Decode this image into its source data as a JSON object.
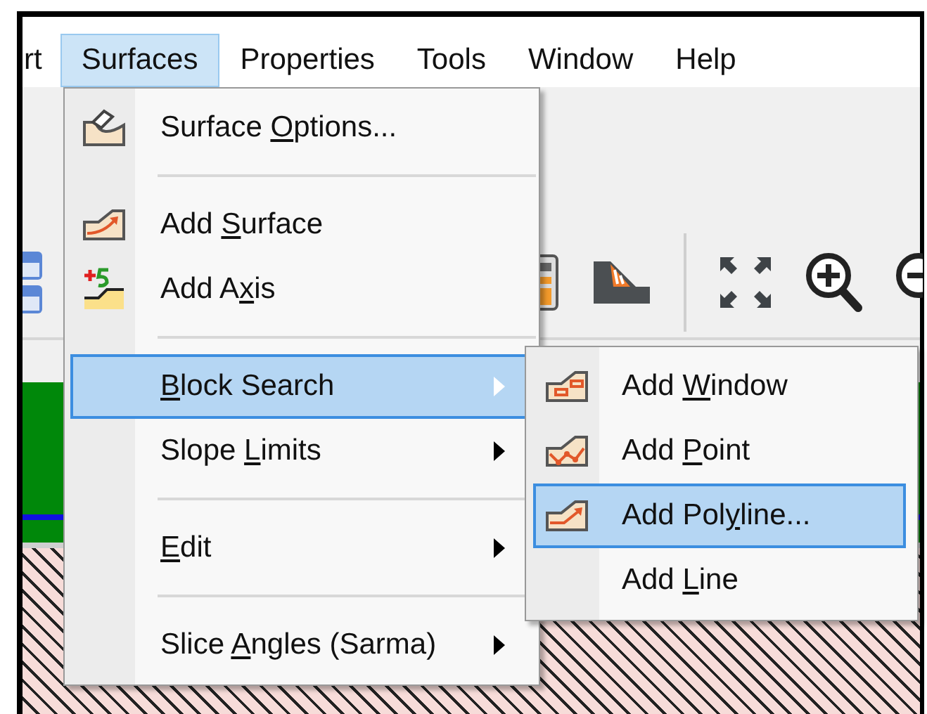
{
  "menubar": [
    {
      "label": "rt",
      "selected": false
    },
    {
      "label": "Surfaces",
      "selected": true
    },
    {
      "label": "Properties",
      "selected": false
    },
    {
      "label": "Tools",
      "selected": false
    },
    {
      "label": "Window",
      "selected": false
    },
    {
      "label": "Help",
      "selected": false
    }
  ],
  "surfaces_menu": {
    "items": [
      {
        "kind": "item",
        "label_parts": [
          "Surface ",
          "O",
          "ptions..."
        ],
        "selected": false,
        "submenu": false
      },
      {
        "kind": "separator"
      },
      {
        "kind": "item",
        "label_parts": [
          "Add ",
          "S",
          "urface"
        ],
        "selected": false,
        "submenu": false
      },
      {
        "kind": "item",
        "label_parts": [
          "Add A",
          "x",
          "is"
        ],
        "selected": false,
        "submenu": false
      },
      {
        "kind": "separator"
      },
      {
        "kind": "item",
        "label_parts": [
          "B",
          "lock Search"
        ],
        "selected": true,
        "submenu": true
      },
      {
        "kind": "item",
        "label_parts": [
          "Slope ",
          "L",
          "imits"
        ],
        "selected": false,
        "submenu": true
      },
      {
        "kind": "separator"
      },
      {
        "kind": "item",
        "label_parts": [
          "E",
          "dit"
        ],
        "selected": false,
        "submenu": true
      },
      {
        "kind": "separator"
      },
      {
        "kind": "item",
        "label_parts": [
          "Slice ",
          "A",
          "ngles (Sarma)"
        ],
        "selected": false,
        "submenu": true
      }
    ]
  },
  "block_search_submenu": {
    "items": [
      {
        "kind": "item",
        "label_parts": [
          "Add ",
          "W",
          "indow"
        ],
        "selected": false
      },
      {
        "kind": "item",
        "label_parts": [
          "Add ",
          "P",
          "oint"
        ],
        "selected": false
      },
      {
        "kind": "item",
        "label_parts": [
          "Add Pol",
          "y",
          "line..."
        ],
        "selected": true
      },
      {
        "kind": "item",
        "label_parts": [
          "Add ",
          "L",
          "ine"
        ],
        "selected": false
      }
    ]
  }
}
